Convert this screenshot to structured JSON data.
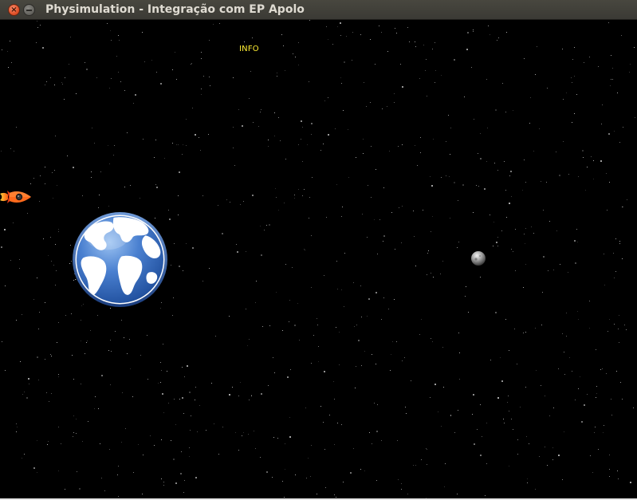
{
  "window": {
    "title": "Physimulation - Integração com EP Apolo",
    "close_glyph": "×",
    "minimize_glyph": "−"
  },
  "simulation": {
    "info_label": "INFO",
    "background_color": "#000000",
    "objects": [
      {
        "name": "earth",
        "icon": "earth-icon"
      },
      {
        "name": "moon",
        "icon": "moon-icon"
      },
      {
        "name": "spaceship",
        "icon": "rocket-icon"
      }
    ]
  },
  "colors": {
    "info_text": "#ffee33",
    "earth_ocean": "#3f74c7",
    "earth_land": "#ffffff",
    "titlebar": "#3c3b37",
    "title_text": "#dfdbd2",
    "close_button": "#e2522a"
  }
}
